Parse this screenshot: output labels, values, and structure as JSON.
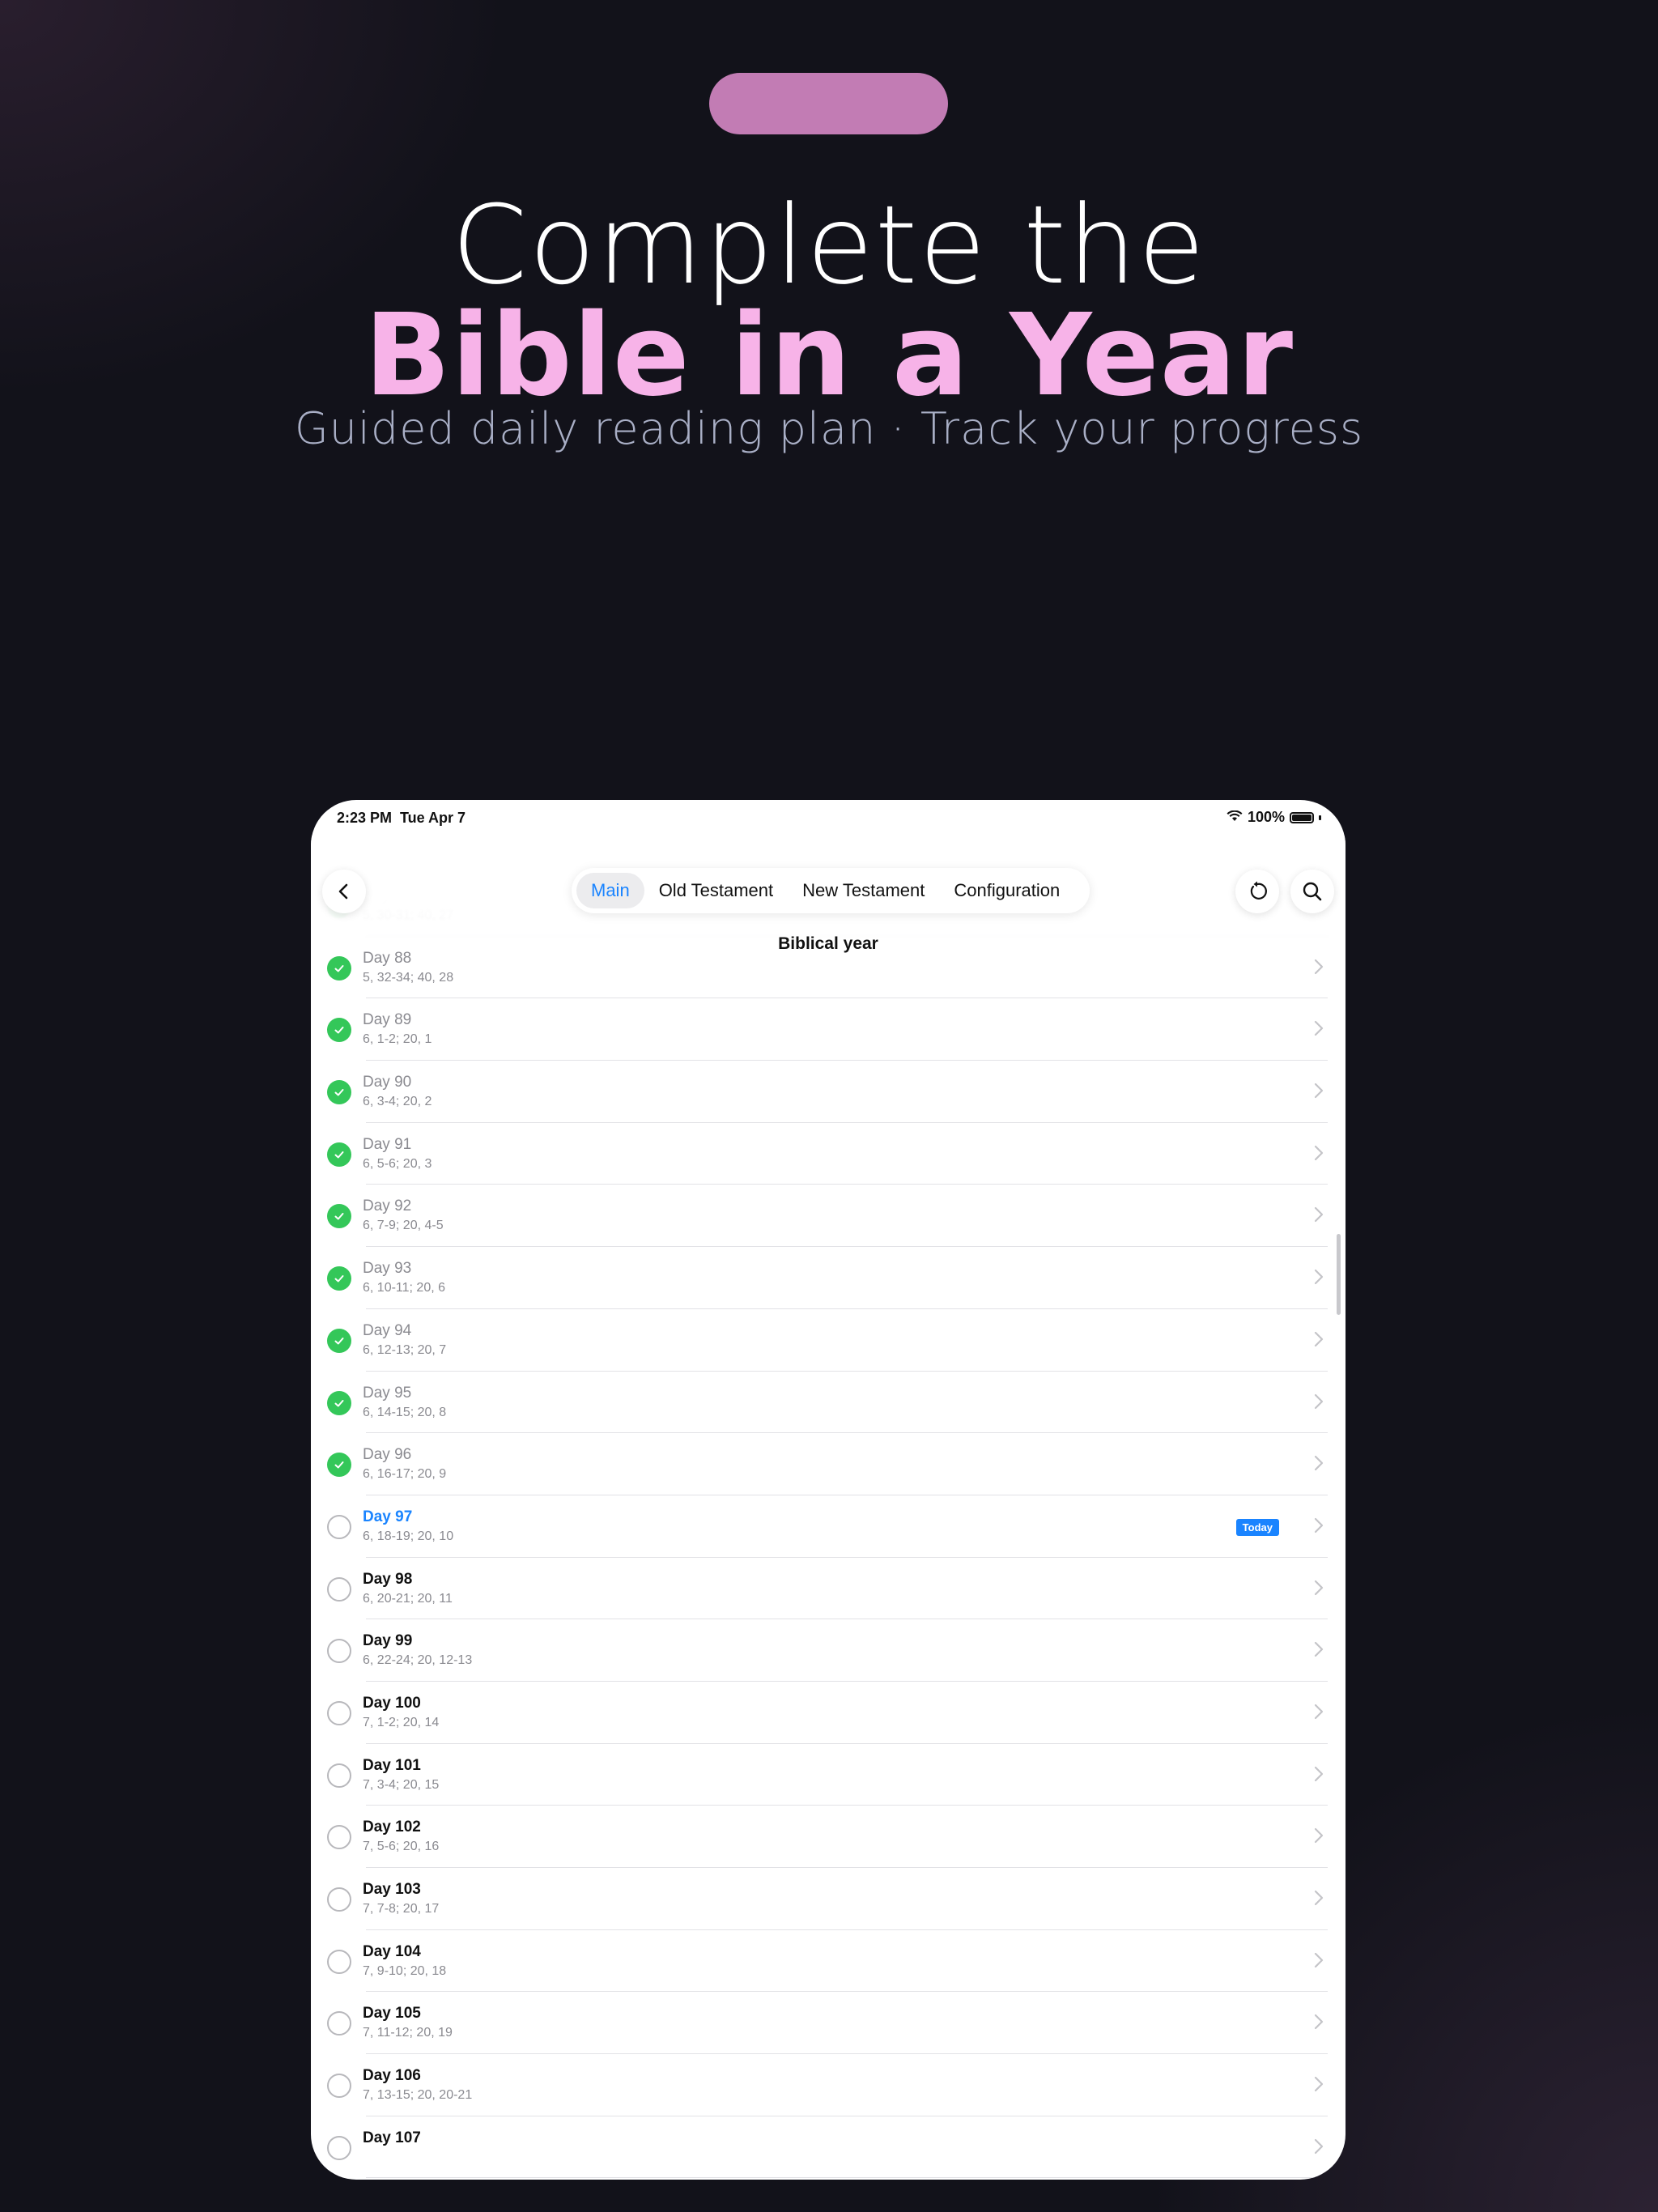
{
  "promo": {
    "headline_line1": "Complete the",
    "headline_line2": "Bible in a Year",
    "subtitle": "Guided daily reading plan · Track your progress"
  },
  "colors": {
    "background": "#12121a",
    "pill": "#c27cb4",
    "headline_accent": "#f7b3e8",
    "subtitle": "#a9afc6",
    "check_green": "#34c759",
    "accent_blue": "#1a84ff"
  },
  "status_bar": {
    "time": "2:23 PM",
    "date": "Tue Apr 7",
    "battery": "100%"
  },
  "navbar": {
    "tabs": [
      "Main",
      "Old Testament",
      "New Testament",
      "Configuration"
    ],
    "active_tab": "Main",
    "title": "Biblical year",
    "icons": [
      "back-icon",
      "refresh-icon",
      "search-icon"
    ]
  },
  "readings": [
    {
      "day": "Day 87",
      "refs": "5, 30-31; 40, 27",
      "status": "done"
    },
    {
      "day": "Day 88",
      "refs": "5, 32-34; 40, 28",
      "status": "done"
    },
    {
      "day": "Day 89",
      "refs": "6, 1-2; 20, 1",
      "status": "done"
    },
    {
      "day": "Day 90",
      "refs": "6, 3-4; 20, 2",
      "status": "done"
    },
    {
      "day": "Day 91",
      "refs": "6, 5-6; 20, 3",
      "status": "done"
    },
    {
      "day": "Day 92",
      "refs": "6, 7-9; 20, 4-5",
      "status": "done"
    },
    {
      "day": "Day 93",
      "refs": "6, 10-11; 20, 6",
      "status": "done"
    },
    {
      "day": "Day 94",
      "refs": "6, 12-13; 20, 7",
      "status": "done"
    },
    {
      "day": "Day 95",
      "refs": "6, 14-15; 20, 8",
      "status": "done"
    },
    {
      "day": "Day 96",
      "refs": "6, 16-17; 20, 9",
      "status": "done"
    },
    {
      "day": "Day 97",
      "refs": "6, 18-19; 20, 10",
      "status": "today",
      "badge": "Today"
    },
    {
      "day": "Day 98",
      "refs": "6, 20-21; 20, 11",
      "status": "open"
    },
    {
      "day": "Day 99",
      "refs": "6, 22-24; 20, 12-13",
      "status": "open"
    },
    {
      "day": "Day 100",
      "refs": "7, 1-2; 20, 14",
      "status": "open"
    },
    {
      "day": "Day 101",
      "refs": "7, 3-4; 20, 15",
      "status": "open"
    },
    {
      "day": "Day 102",
      "refs": "7, 5-6; 20, 16",
      "status": "open"
    },
    {
      "day": "Day 103",
      "refs": "7, 7-8; 20, 17",
      "status": "open"
    },
    {
      "day": "Day 104",
      "refs": "7, 9-10; 20, 18",
      "status": "open"
    },
    {
      "day": "Day 105",
      "refs": "7, 11-12; 20, 19",
      "status": "open"
    },
    {
      "day": "Day 106",
      "refs": "7, 13-15; 20, 20-21",
      "status": "open"
    },
    {
      "day": "Day 107",
      "refs": "",
      "status": "open"
    }
  ]
}
